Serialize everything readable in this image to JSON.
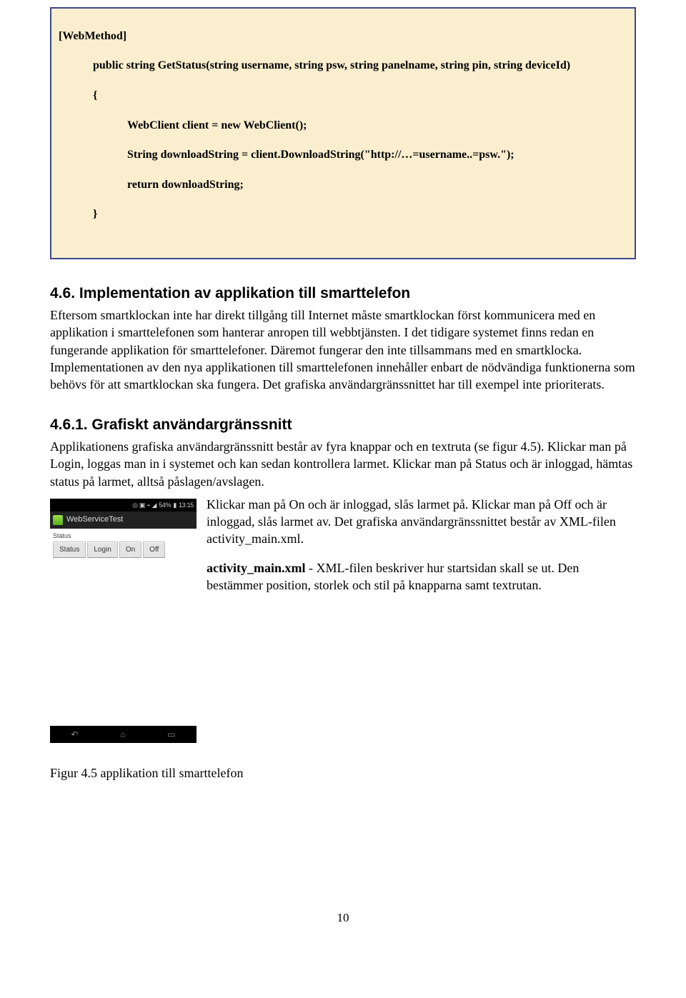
{
  "codebox": {
    "l1": "[WebMethod]",
    "l2": "public string GetStatus(string username, string psw, string panelname, string pin, string deviceId)",
    "l3": "{",
    "l4": "WebClient client = new WebClient();",
    "l5": "String downloadString = client.DownloadString(\"http://…=username..=psw.\");",
    "l6": "return downloadString;",
    "l7": "}"
  },
  "section": {
    "number": "4.6.",
    "title": "Implementation av applikation till smarttelefon",
    "body": "Eftersom smartklockan inte har direkt tillgång till Internet måste smartklockan först kommunicera med en applikation i smarttelefonen som hanterar anropen till webbtjänsten. I det tidigare systemet finns redan en fungerande applikation för smarttelefoner. Däremot fungerar den inte tillsammans med en smartklocka. Implementationen av den nya applikationen till smarttelefonen innehåller enbart de nödvändiga funktionerna som behövs för att smartklockan ska fungera. Det grafiska användargränssnittet har till exempel inte prioriterats."
  },
  "subsection": {
    "number": "4.6.1.",
    "title": "Grafiskt användargränssnitt",
    "body_before": "Applikationens grafiska användargränssnitt består av fyra knappar och en textruta (se figur 4.5). Klickar man på Login, loggas man in i systemet och kan sedan kontrollera larmet. Klickar man på Status och är inloggad, hämtas status på larmet, alltså påslagen/avslagen.",
    "body_wrap": "Klickar man på On och är inloggad, slås larmet på. Klickar man på Off och är inloggad, slås larmet av. Det grafiska användargränssnittet består av XML-filen activity_main.xml.",
    "body_wrap2_bold": "activity_main.xml",
    "body_wrap2_rest": " - XML-filen beskriver hur startsidan skall se ut. Den bestämmer position, storlek och stil på knapparna samt textrutan."
  },
  "phone": {
    "statusbar": {
      "icons": "◎ ▣ ⌁ ◢",
      "battery": "54%",
      "battery_icon": "▮",
      "time": "13:15"
    },
    "titlebar": "WebServiceTest",
    "status_label": "Status",
    "buttons": {
      "b1": "Status",
      "b2": "Login",
      "b3": "On",
      "b4": "Off"
    },
    "nav": {
      "back": "↶",
      "home": "⌂",
      "recent": "▭"
    }
  },
  "caption": "Figur 4.5 applikation till smarttelefon",
  "page_number": "10"
}
